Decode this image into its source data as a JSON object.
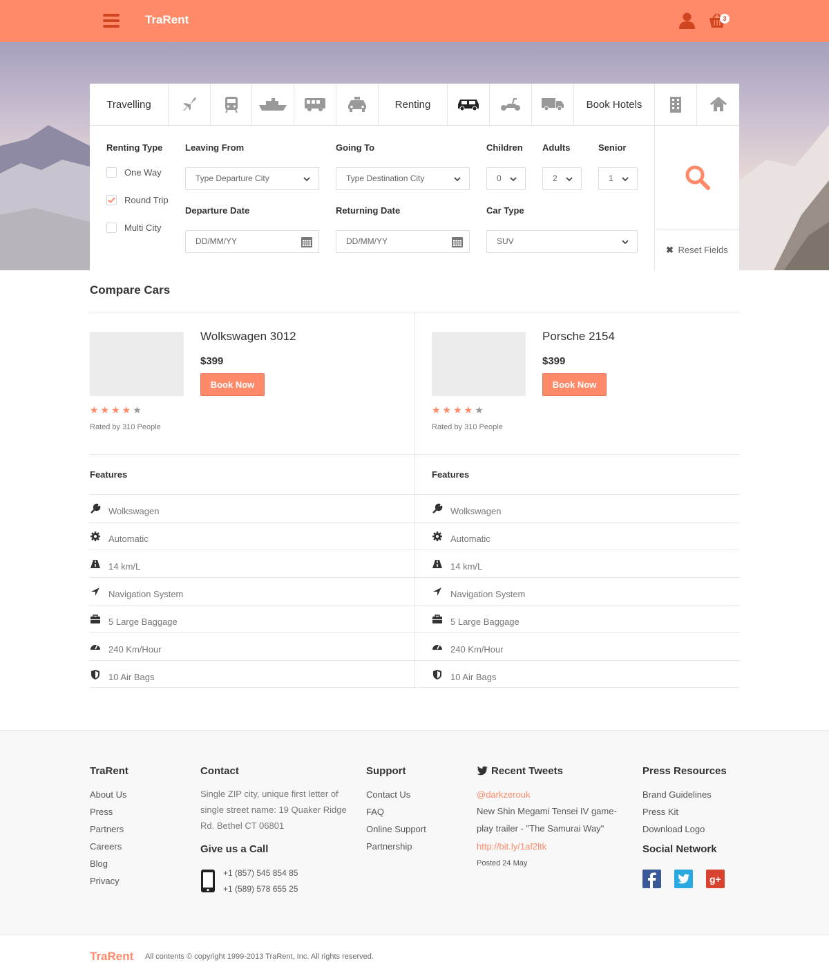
{
  "header": {
    "brand": "TraRent",
    "cart_count": "3"
  },
  "tabs": {
    "travelling": "Travelling",
    "renting": "Renting",
    "book_hotels": "Book Hotels"
  },
  "form": {
    "renting_type_label": "Renting Type",
    "options": [
      {
        "label": "One Way",
        "checked": false
      },
      {
        "label": "Round Trip",
        "checked": true
      },
      {
        "label": "Multi City",
        "checked": false
      }
    ],
    "leaving_from_label": "Leaving From",
    "leaving_from_placeholder": "Type Departure City",
    "going_to_label": "Going To",
    "going_to_placeholder": "Type Destination City",
    "children_label": "Children",
    "children_value": "0",
    "adults_label": "Adults",
    "adults_value": "2",
    "senior_label": "Senior",
    "senior_value": "1",
    "departure_date_label": "Departure Date",
    "departure_date_placeholder": "DD/MM/YY",
    "returning_date_label": "Returning Date",
    "returning_date_placeholder": "DD/MM/YY",
    "car_type_label": "Car Type",
    "car_type_value": "SUV",
    "reset_label": "Reset Fields"
  },
  "compare": {
    "title": "Compare Cars",
    "features_label": "Features",
    "cars": [
      {
        "name": "Wolkswagen 3012",
        "price": "$399",
        "book_label": "Book Now",
        "rating": 4,
        "rated": "Rated by 310 People",
        "features": [
          "Wolkswagen",
          "Automatic",
          "14 km/L",
          "Navigation System",
          "5 Large Baggage",
          "240 Km/Hour",
          "10 Air Bags"
        ]
      },
      {
        "name": "Porsche 2154",
        "price": "$399",
        "book_label": "Book Now",
        "rating": 4,
        "rated": "Rated by 310 People",
        "features": [
          "Wolkswagen",
          "Automatic",
          "14 km/L",
          "Navigation System",
          "5 Large Baggage",
          "240 Km/Hour",
          "10 Air Bags"
        ]
      }
    ]
  },
  "footer": {
    "col1": {
      "title": "TraRent",
      "links": [
        "About Us",
        "Press",
        "Partners",
        "Careers",
        "Blog",
        "Privacy"
      ]
    },
    "contact": {
      "title": "Contact",
      "address_lines": [
        "Single ZIP city, unique first letter of",
        "single street name: 19 Quaker Ridge",
        "Rd. Bethel CT 06801"
      ],
      "call_title": "Give us a Call",
      "phones": [
        "+1 (857) 545 854 85",
        "+1 (589) 578 655 25"
      ]
    },
    "support": {
      "title": "Support",
      "links": [
        "Contact Us",
        "FAQ",
        "Online Support",
        "Partnership"
      ]
    },
    "tweets": {
      "title": "Recent Tweets",
      "handle": "@darkzerouk",
      "text_lines": [
        "New Shin Megami Tensei IV game-",
        "play trailer - \"The Samurai Way\""
      ],
      "link": "http://bit.ly/1af2ltk",
      "posted": "Posted 24 May"
    },
    "press": {
      "title": "Press Resources",
      "links": [
        "Brand Guidelines",
        "Press Kit",
        "Download Logo"
      ]
    },
    "social_title": "Social Network"
  },
  "bottom": {
    "brand": "TraRent",
    "copyright": "All contents © copyright 1999-2013 TraRent, Inc. All rights reserved."
  },
  "colors": {
    "accent": "#ff8a6a",
    "accent_dark": "#d0451f"
  }
}
